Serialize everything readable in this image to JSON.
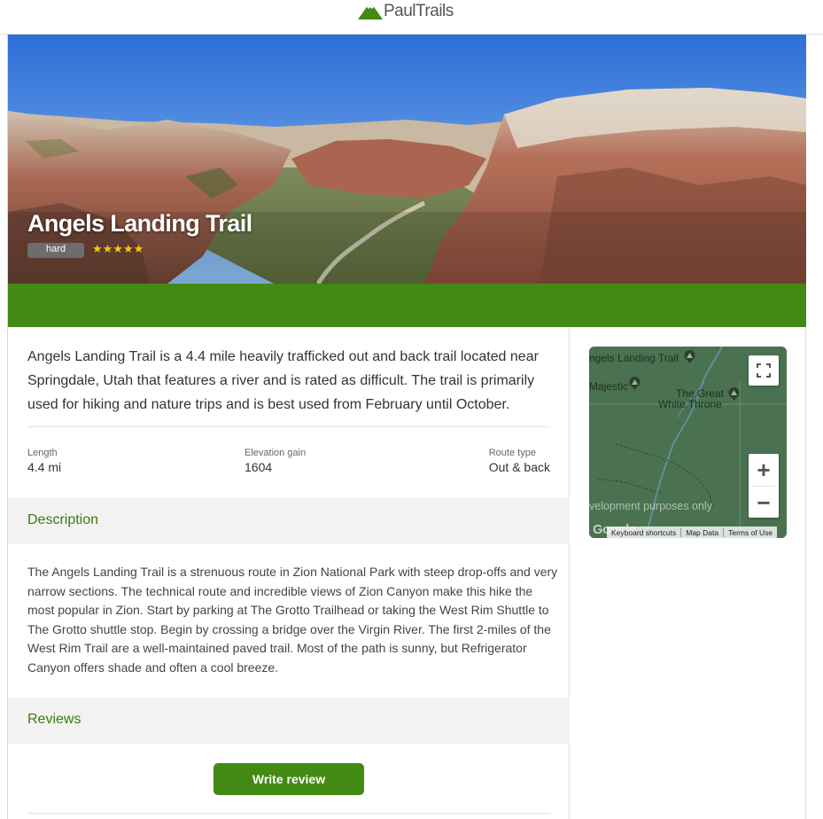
{
  "header": {
    "logo_text": "PaulTrails",
    "logo_icon": "mountain-icon",
    "brand_color": "#428a13"
  },
  "hero": {
    "title": "Angels Landing Trail",
    "difficulty": "hard",
    "stars": "★★★★★",
    "rating": 5
  },
  "summary": "Angels Landing Trail is a 4.4 mile heavily trafficked out and back trail located near Springdale, Utah that features a river and is rated as difficult. The trail is primarily used for hiking and nature trips and is best used from February until October.",
  "stats": {
    "length_label": "Length",
    "length_value": "4.4 mi",
    "elevation_label": "Elevation gain",
    "elevation_value": "1604",
    "route_label": "Route type",
    "route_value": "Out & back"
  },
  "description": {
    "heading": "Description",
    "text": "The Angels Landing Trail is a strenuous route in Zion National Park with steep drop-offs and very narrow sections. The technical route and incredible views of Zion Canyon make this hike the most popular in Zion. Start by parking at The Grotto Trailhead or taking the West Rim Shuttle to The Grotto shuttle stop. Begin by crossing a bridge over the Virgin River. The first 2-miles of the West Rim Trail are a well-maintained paved trail. Most of the path is sunny, but Refrigerator Canyon offers shade and often a cool breeze."
  },
  "reviews": {
    "heading": "Reviews",
    "write_button": "Write review"
  },
  "map": {
    "label_trail": "ngels Landing Trail",
    "label_majestic": "Majestic",
    "label_throne_1": "The Great",
    "label_throne_2": "White Throne",
    "dev_notice": "velopment purposes only",
    "google": "Google",
    "zoom_in": "+",
    "zoom_out": "−",
    "footer": [
      "Keyboard shortcuts",
      "Map Data",
      "Terms of Use"
    ]
  }
}
